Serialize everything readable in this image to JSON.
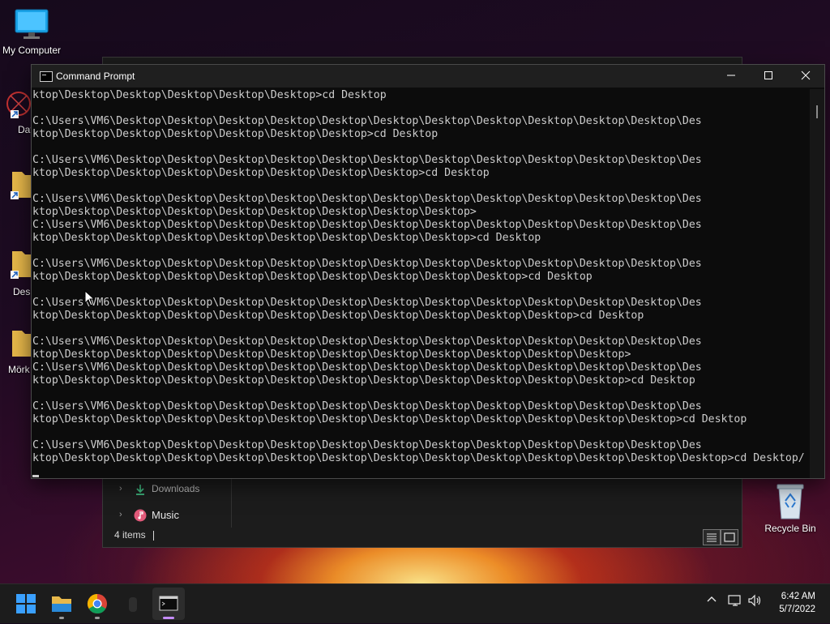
{
  "desktop": {
    "icons": [
      {
        "label": "My Computer"
      },
      {
        "label": "DataW"
      },
      {
        "label": ""
      },
      {
        "label": "Desk"
      },
      {
        "label": "Mörk"
      }
    ],
    "recycle_bin": "Recycle Bin"
  },
  "explorer": {
    "nav_items": [
      {
        "label": "Downloads",
        "icon": "download-icon"
      },
      {
        "label": "Music",
        "icon": "music-icon"
      }
    ],
    "status": "4 items"
  },
  "cmd": {
    "title": "Command Prompt",
    "lines": [
      "ktop\\Desktop\\Desktop\\Desktop\\Desktop\\Desktop>cd Desktop",
      "",
      "C:\\Users\\VM6\\Desktop\\Desktop\\Desktop\\Desktop\\Desktop\\Desktop\\Desktop\\Desktop\\Desktop\\Desktop\\Desktop\\Des",
      "ktop\\Desktop\\Desktop\\Desktop\\Desktop\\Desktop\\Desktop>cd Desktop",
      "",
      "C:\\Users\\VM6\\Desktop\\Desktop\\Desktop\\Desktop\\Desktop\\Desktop\\Desktop\\Desktop\\Desktop\\Desktop\\Desktop\\Des",
      "ktop\\Desktop\\Desktop\\Desktop\\Desktop\\Desktop\\Desktop\\Desktop>cd Desktop",
      "",
      "C:\\Users\\VM6\\Desktop\\Desktop\\Desktop\\Desktop\\Desktop\\Desktop\\Desktop\\Desktop\\Desktop\\Desktop\\Desktop\\Des",
      "ktop\\Desktop\\Desktop\\Desktop\\Desktop\\Desktop\\Desktop\\Desktop\\Desktop>",
      "C:\\Users\\VM6\\Desktop\\Desktop\\Desktop\\Desktop\\Desktop\\Desktop\\Desktop\\Desktop\\Desktop\\Desktop\\Desktop\\Des",
      "ktop\\Desktop\\Desktop\\Desktop\\Desktop\\Desktop\\Desktop\\Desktop\\Desktop>cd Desktop",
      "",
      "C:\\Users\\VM6\\Desktop\\Desktop\\Desktop\\Desktop\\Desktop\\Desktop\\Desktop\\Desktop\\Desktop\\Desktop\\Desktop\\Des",
      "ktop\\Desktop\\Desktop\\Desktop\\Desktop\\Desktop\\Desktop\\Desktop\\Desktop\\Desktop>cd Desktop",
      "",
      "C:\\Users\\VM6\\Desktop\\Desktop\\Desktop\\Desktop\\Desktop\\Desktop\\Desktop\\Desktop\\Desktop\\Desktop\\Desktop\\Des",
      "ktop\\Desktop\\Desktop\\Desktop\\Desktop\\Desktop\\Desktop\\Desktop\\Desktop\\Desktop\\Desktop>cd Desktop",
      "",
      "C:\\Users\\VM6\\Desktop\\Desktop\\Desktop\\Desktop\\Desktop\\Desktop\\Desktop\\Desktop\\Desktop\\Desktop\\Desktop\\Des",
      "ktop\\Desktop\\Desktop\\Desktop\\Desktop\\Desktop\\Desktop\\Desktop\\Desktop\\Desktop\\Desktop\\Desktop>",
      "C:\\Users\\VM6\\Desktop\\Desktop\\Desktop\\Desktop\\Desktop\\Desktop\\Desktop\\Desktop\\Desktop\\Desktop\\Desktop\\Des",
      "ktop\\Desktop\\Desktop\\Desktop\\Desktop\\Desktop\\Desktop\\Desktop\\Desktop\\Desktop\\Desktop\\Desktop>cd Desktop",
      "",
      "C:\\Users\\VM6\\Desktop\\Desktop\\Desktop\\Desktop\\Desktop\\Desktop\\Desktop\\Desktop\\Desktop\\Desktop\\Desktop\\Des",
      "ktop\\Desktop\\Desktop\\Desktop\\Desktop\\Desktop\\Desktop\\Desktop\\Desktop\\Desktop\\Desktop\\Desktop\\Desktop>cd Desktop",
      "",
      "C:\\Users\\VM6\\Desktop\\Desktop\\Desktop\\Desktop\\Desktop\\Desktop\\Desktop\\Desktop\\Desktop\\Desktop\\Desktop\\Des",
      "ktop\\Desktop\\Desktop\\Desktop\\Desktop\\Desktop\\Desktop\\Desktop\\Desktop\\Desktop\\Desktop\\Desktop\\Desktop\\Desktop>cd Desktop/"
    ]
  },
  "taskbar": {
    "clock_time": "6:42 AM",
    "clock_date": "5/7/2022",
    "apps": [
      "windows-start-icon",
      "file-explorer-icon",
      "chrome-icon",
      "app-icon",
      "terminal-icon"
    ]
  }
}
